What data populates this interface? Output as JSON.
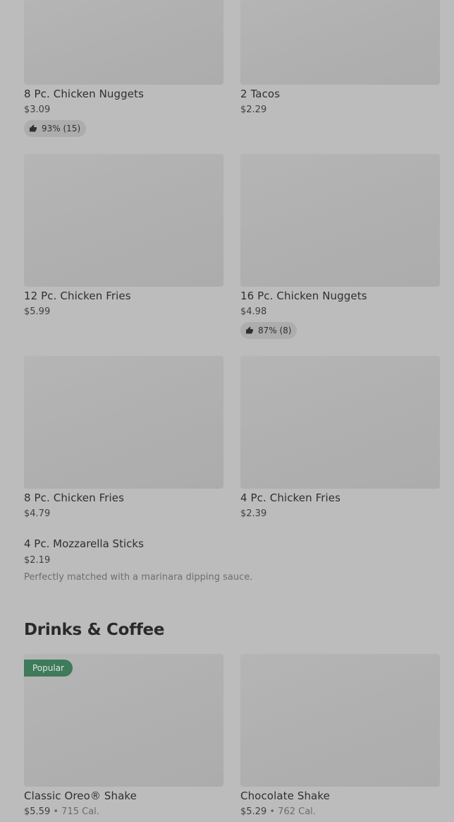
{
  "menu": {
    "items": [
      {
        "name": "8 Pc. Chicken Nuggets",
        "price": "$3.09",
        "rating": "93% (15)"
      },
      {
        "name": "2 Tacos",
        "price": "$2.29"
      },
      {
        "name": "12 Pc. Chicken Fries",
        "price": "$5.99"
      },
      {
        "name": "16 Pc. Chicken Nuggets",
        "price": "$4.98",
        "rating": "87% (8)"
      },
      {
        "name": "8 Pc. Chicken Fries",
        "price": "$4.79"
      },
      {
        "name": "4 Pc. Chicken Fries",
        "price": "$2.39"
      }
    ],
    "featured": {
      "name": "4 Pc. Mozzarella Sticks",
      "price": "$2.19",
      "description": "Perfectly matched with a marinara dipping sauce."
    }
  },
  "drinks": {
    "section_title": "Drinks & Coffee",
    "items": [
      {
        "name": "Classic Oreo® Shake",
        "price": "$5.59",
        "separator": "•",
        "calories": "715 Cal.",
        "badge": "Popular"
      },
      {
        "name": "Chocolate Shake",
        "price": "$5.29",
        "separator": "•",
        "calories": "762 Cal."
      }
    ]
  },
  "icons": {
    "rating": "thumbs-up-icon"
  },
  "colors": {
    "background": "#bcbcbc",
    "image_placeholder": "#b0b0b0",
    "popular_badge": "#3e7a5b",
    "rating_pill": "#adadad"
  }
}
